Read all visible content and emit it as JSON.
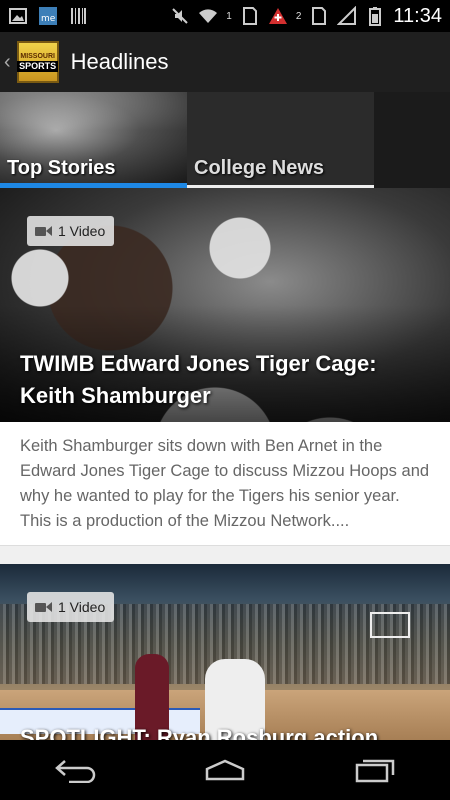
{
  "status_bar": {
    "time": "11:34",
    "notif_count_a": "1",
    "notif_count_b": "2",
    "icons": [
      "image-icon",
      "sports-app-icon",
      "barcode-icon",
      "mute-icon",
      "wifi-icon",
      "sim-icon",
      "swiss-app-icon",
      "sim-icon",
      "signal-icon",
      "battery-icon"
    ]
  },
  "header": {
    "logo_top": "MISSOURI",
    "logo_main": "SPORTS",
    "title": "Headlines"
  },
  "tabs": [
    {
      "label": "Top Stories",
      "selected": true
    },
    {
      "label": "College News",
      "selected": false
    },
    {
      "label": "",
      "selected": false
    }
  ],
  "feed": [
    {
      "badge": "1 Video",
      "title": "TWIMB Edward Jones Tiger Cage: Keith Shamburger",
      "summary": "Keith Shamburger sits down with Ben Arnet in the Edward Jones Tiger Cage to discuss Mizzou Hoops and why he wanted to play for the Tigers his senior year. This is a production of the Mizzou Network...."
    },
    {
      "badge": "1 Video",
      "title": "SPOTLIGHT: Ryan Rosburg action"
    }
  ],
  "colors": {
    "accent": "#1e88e5",
    "background": "#f0f0f0",
    "header": "#1f1f1f"
  }
}
